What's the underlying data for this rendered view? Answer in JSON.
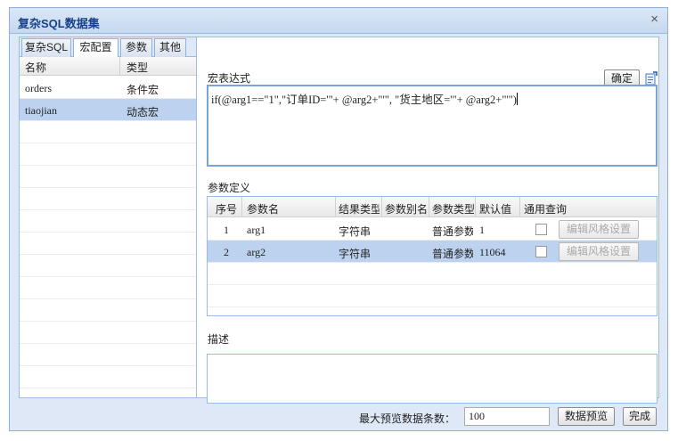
{
  "window": {
    "title": "复杂SQL数据集",
    "close": "×"
  },
  "tabs": [
    "复杂SQL",
    "宏配置",
    "参数",
    "其他"
  ],
  "macro_list": {
    "headers": [
      "名称",
      "类型"
    ],
    "rows": [
      {
        "name": "orders",
        "type": "条件宏"
      },
      {
        "name": "tiaojian",
        "type": "动态宏"
      }
    ]
  },
  "expression": {
    "label": "宏表达式",
    "confirm": "确定",
    "value": "if(@arg1==\"1\",\"订单ID='\"+ @arg2+\"'\", \"货主地区='\"+ @arg2+\"'\")"
  },
  "params": {
    "label": "参数定义",
    "headers": [
      "序号",
      "参数名",
      "结果类型",
      "参数别名",
      "参数类型",
      "默认值",
      "通用查询"
    ],
    "rows": [
      {
        "no": "1",
        "name": "arg1",
        "result_type": "字符串",
        "alias": "",
        "param_type": "普通参数",
        "default": "1",
        "edit": "编辑风格设置"
      },
      {
        "no": "2",
        "name": "arg2",
        "result_type": "字符串",
        "alias": "",
        "param_type": "普通参数",
        "default": "11064",
        "edit": "编辑风格设置"
      }
    ]
  },
  "description": {
    "label": "描述",
    "value": ""
  },
  "footer": {
    "max_rows_label": "最大预览数据条数：",
    "max_rows_value": "100",
    "preview": "数据预览",
    "done": "完成"
  }
}
